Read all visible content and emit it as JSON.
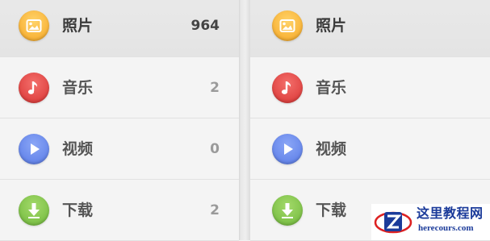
{
  "left_panel": {
    "items": [
      {
        "icon": "photo-icon",
        "label": "照片",
        "count": "964",
        "selected": true
      },
      {
        "icon": "music-note-icon",
        "label": "音乐",
        "count": "2"
      },
      {
        "icon": "play-icon",
        "label": "视频",
        "count": "0"
      },
      {
        "icon": "download-arrow-icon",
        "label": "下载",
        "count": "2"
      }
    ]
  },
  "right_panel": {
    "items": [
      {
        "icon": "photo-icon",
        "label": "照片",
        "selected": true
      },
      {
        "icon": "music-note-icon",
        "label": "音乐"
      },
      {
        "icon": "play-icon",
        "label": "视频"
      },
      {
        "icon": "download-arrow-icon",
        "label": "下载"
      }
    ]
  },
  "watermark": {
    "title": "这里教程网",
    "url": "herecours.com"
  },
  "colors": {
    "photo": "#f6a623",
    "music": "#d93232",
    "video": "#5779e6",
    "download": "#6fb83a"
  }
}
